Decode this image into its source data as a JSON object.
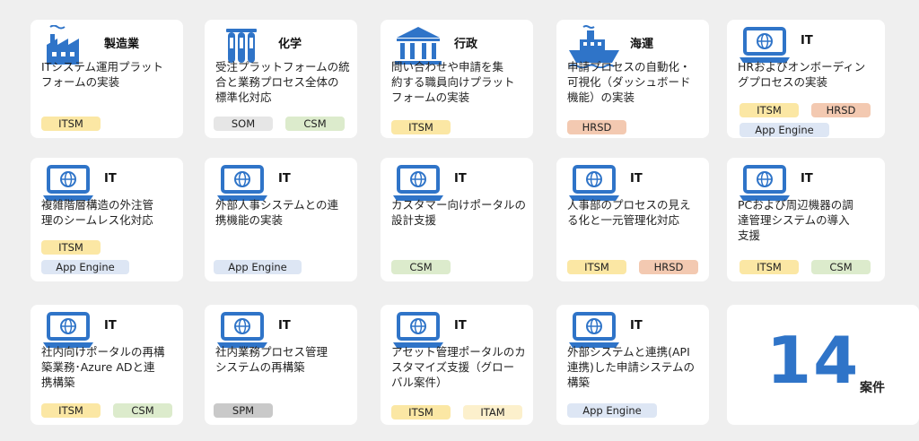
{
  "colors": {
    "icon_blue": "#2f74c8",
    "itsm": "#fbe7a4",
    "csm": "#dcebcc",
    "som": "#e6e6e6",
    "hrsd": "#f3c9b1",
    "app_engine": "#dde6f4",
    "spm": "#c9c9c9",
    "itam": "#fcf0cc"
  },
  "cards": [
    {
      "icon": "factory-icon",
      "title": "製造業",
      "desc": [
        "ITシステム運用プラット",
        "フォームの実装"
      ],
      "tags": [
        "ITSM"
      ]
    },
    {
      "icon": "test-tubes-icon",
      "title": "化学",
      "desc": [
        "受注プラットフォームの統",
        "合と業務プロセス全体の",
        "標準化対応"
      ],
      "tags": [
        "SOM",
        "CSM"
      ]
    },
    {
      "icon": "government-building-icon",
      "title": "行政",
      "desc": [
        "問い合わせや申請を集",
        "約する職員向けプラット",
        "フォームの実装"
      ],
      "tags": [
        "ITSM"
      ]
    },
    {
      "icon": "ship-icon",
      "title": "海運",
      "desc": [
        "申請プロセスの自動化・",
        "可視化（ダッシュボード",
        "機能）の実装"
      ],
      "tags": [
        "HRSD"
      ]
    },
    {
      "icon": "laptop-globe-icon",
      "title": "IT",
      "desc": [
        "HRおよびオンボーディン",
        "グプロセスの実装"
      ],
      "tags": [
        "ITSM",
        "HRSD",
        "App Engine"
      ]
    },
    {
      "icon": "laptop-globe-icon",
      "title": "IT",
      "desc": [
        "複雑階層構造の外注管",
        "理のシームレス化対応"
      ],
      "tags": [
        "ITSM",
        "App Engine"
      ]
    },
    {
      "icon": "laptop-globe-icon",
      "title": "IT",
      "desc": [
        "外部人事システムとの連",
        "携機能の実装"
      ],
      "tags": [
        "App Engine"
      ]
    },
    {
      "icon": "laptop-globe-icon",
      "title": "IT",
      "desc": [
        "カスタマー向けポータルの",
        "設計支援"
      ],
      "tags": [
        "CSM"
      ]
    },
    {
      "icon": "laptop-globe-icon",
      "title": "IT",
      "desc": [
        "人事部のプロセスの見え",
        "る化と一元管理化対応"
      ],
      "tags": [
        "ITSM",
        "HRSD"
      ]
    },
    {
      "icon": "laptop-globe-icon",
      "title": "IT",
      "desc": [
        "PCおよび周辺機器の調",
        "達管理システムの導入",
        "支援"
      ],
      "tags": [
        "ITSM",
        "CSM"
      ]
    },
    {
      "icon": "laptop-globe-icon",
      "title": "IT",
      "desc": [
        "社内向けポータルの再構",
        "築業務･Azure ADと連",
        "携構築"
      ],
      "tags": [
        "ITSM",
        "CSM"
      ]
    },
    {
      "icon": "laptop-globe-icon",
      "title": "IT",
      "desc": [
        "社内業務プロセス管理",
        "システムの再構築"
      ],
      "tags": [
        "SPM"
      ]
    },
    {
      "icon": "laptop-globe-icon",
      "title": "IT",
      "desc": [
        "アセット管理ポータルのカ",
        "スタマイズ支援（グロー",
        "バル案件）"
      ],
      "tags": [
        "ITSM",
        "ITAM"
      ]
    },
    {
      "icon": "laptop-globe-icon",
      "title": "IT",
      "desc": [
        "外部システムと連携(API",
        "連携)した申請システムの",
        "構築"
      ],
      "tags": [
        "App Engine"
      ]
    }
  ],
  "summary": {
    "count": "14",
    "unit": "案件"
  }
}
